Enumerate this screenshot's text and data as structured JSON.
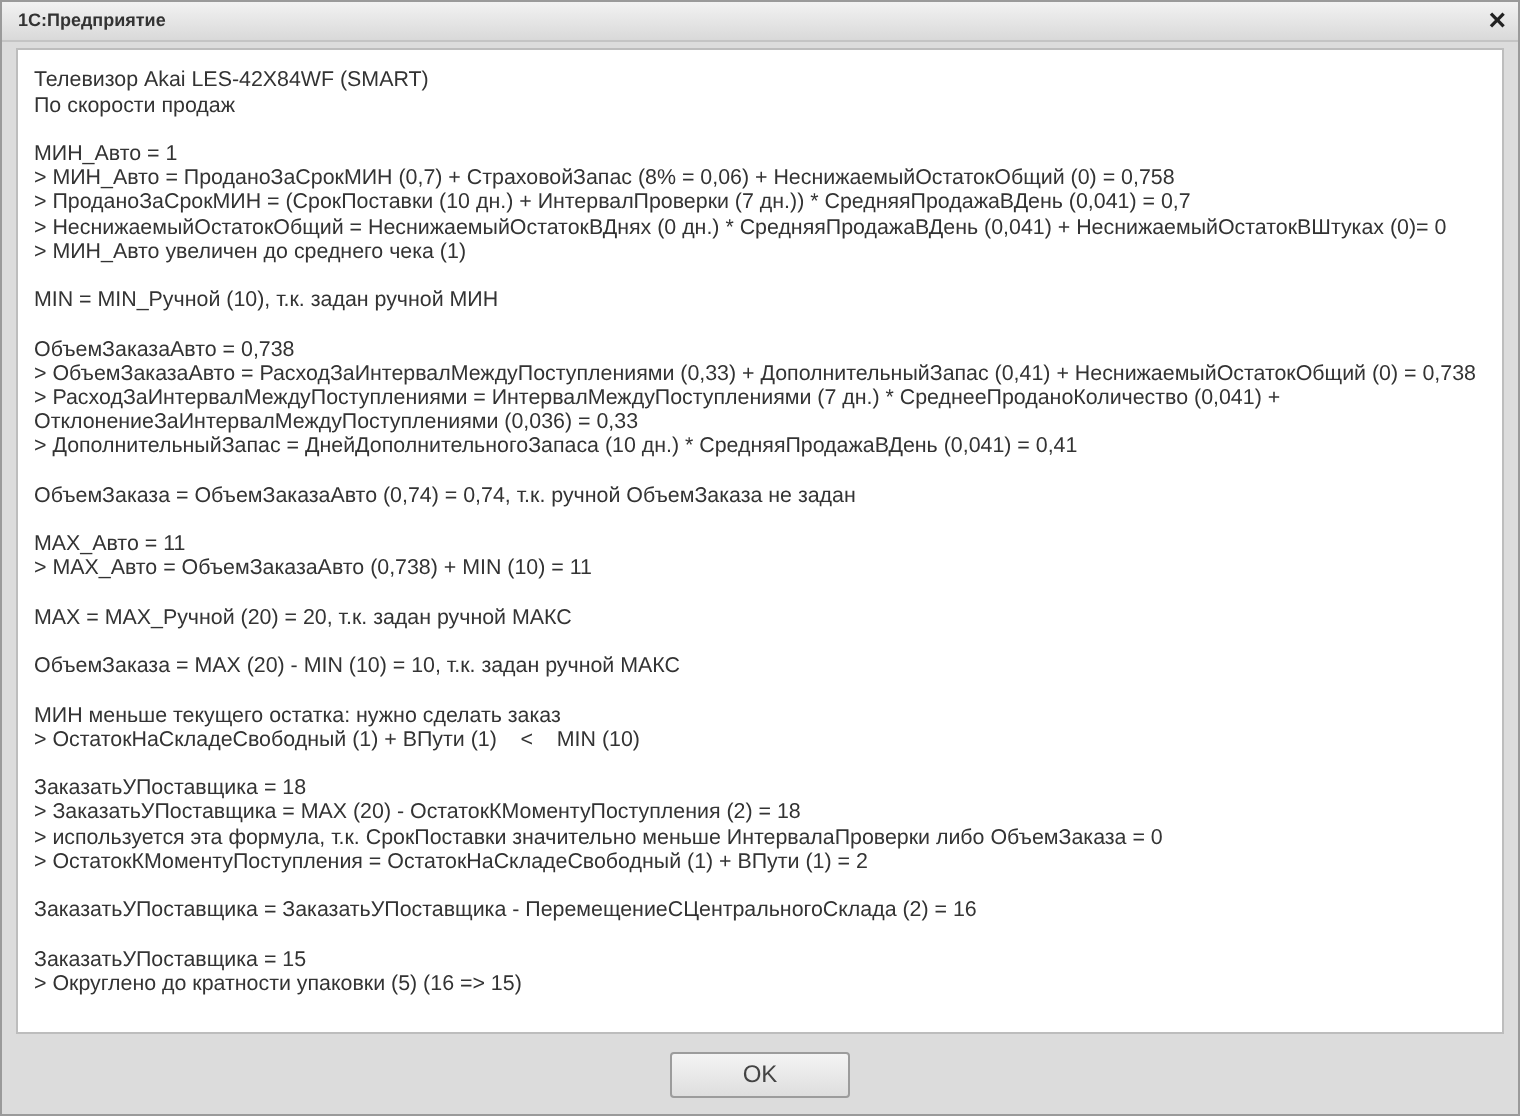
{
  "window": {
    "title": "1С:Предприятие",
    "close": "×"
  },
  "blocks": [
    [
      "Телевизор Akai LES-42X84WF (SMART)",
      "По скорости продаж"
    ],
    [
      "МИН_Авто = 1",
      "> МИН_Авто = ПроданоЗаСрокМИН (0,7) + СтраховойЗапас (8% = 0,06) + НеснижаемыйОстатокОбщий (0) = 0,758",
      "> ПроданоЗаСрокМИН = (СрокПоставки (10 дн.) + ИнтервалПроверки (7 дн.)) * СредняяПродажаВДень (0,041) = 0,7",
      "> НеснижаемыйОстатокОбщий = НеснижаемыйОстатокВДнях (0 дн.) * СредняяПродажаВДень (0,041) + НеснижаемыйОстатокВШтуках (0)= 0",
      "> МИН_Авто увеличен до среднего чека (1)"
    ],
    [
      "MIN = MIN_Ручной (10), т.к. задан ручной МИН"
    ],
    [
      "ОбъемЗаказаАвто = 0,738",
      "> ОбъемЗаказаАвто = РасходЗаИнтервалМеждуПоступлениями (0,33) + ДополнительныйЗапас (0,41) + НеснижаемыйОстатокОбщий (0) = 0,738",
      "> РасходЗаИнтервалМеждуПоступлениями = ИнтервалМеждуПоступлениями (7 дн.) * СреднееПроданоКоличество (0,041) +",
      "ОтклонениеЗаИнтервалМеждуПоступлениями (0,036) = 0,33",
      "> ДополнительныйЗапас = ДнейДополнительногоЗапаса (10 дн.) * СредняяПродажаВДень (0,041) = 0,41"
    ],
    [
      "ОбъемЗаказа = ОбъемЗаказаАвто (0,74) = 0,74, т.к. ручной ОбъемЗаказа не задан"
    ],
    [
      "MAX_Авто = 11",
      "> MAX_Авто = ОбъемЗаказаАвто (0,738) + MIN (10) = 11"
    ],
    [
      "MAX = MAX_Ручной (20) = 20, т.к. задан ручной МАКС"
    ],
    [
      "ОбъемЗаказа = MAX (20) - MIN (10) = 10, т.к. задан ручной МАКС"
    ],
    [
      "МИН меньше текущего остатка: нужно сделать заказ",
      "> ОстатокНаСкладеСвободный (1) + ВПути (1)    <    MIN (10)"
    ],
    [
      "ЗаказатьУПоставщика = 18",
      "> ЗаказатьУПоставщика = MAX (20) - ОстатокКМоментуПоступления (2) = 18",
      "> используется эта формула, т.к. СрокПоставки значительно меньше ИнтервалаПроверки либо ОбъемЗаказа = 0",
      "> ОстатокКМоментуПоступления = ОстатокНаСкладеСвободный (1) + ВПути (1) = 2"
    ],
    [
      "ЗаказатьУПоставщика = ЗаказатьУПоставщика - ПеремещениеСЦентральногоСклада (2) = 16"
    ],
    [
      "ЗаказатьУПоставщика = 15",
      "> Округлено до кратности упаковки (5) (16 => 15)"
    ]
  ],
  "buttons": [
    "OK"
  ]
}
